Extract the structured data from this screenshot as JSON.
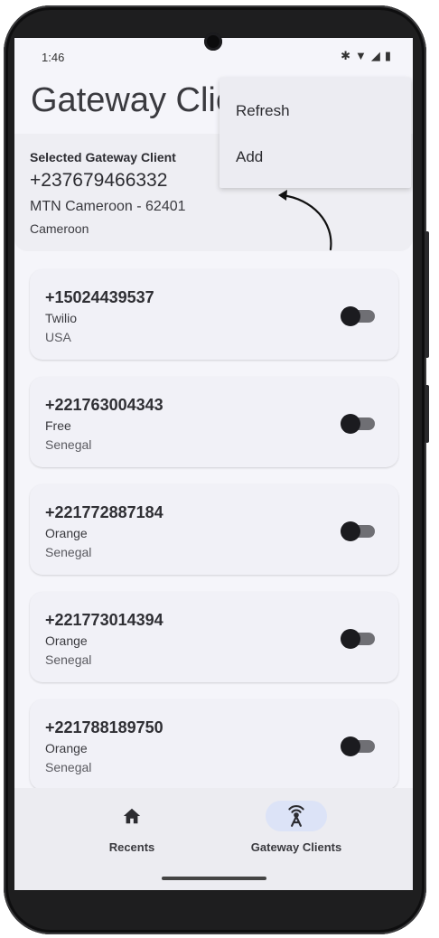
{
  "status_bar": {
    "time": "1:46",
    "icons": [
      "bluetooth-icon",
      "wifi-icon",
      "signal-icon",
      "battery-icon"
    ]
  },
  "header": {
    "title": "Gateway Clients"
  },
  "menu": {
    "items": [
      "Refresh",
      "Add"
    ]
  },
  "selected_client": {
    "label": "Selected Gateway Client",
    "number": "+237679466332",
    "operator": "MTN Cameroon - 62401",
    "country": "Cameroon"
  },
  "clients": [
    {
      "number": "+15024439537",
      "operator": "Twilio",
      "country": "USA",
      "enabled": false
    },
    {
      "number": "+221763004343",
      "operator": "Free",
      "country": "Senegal",
      "enabled": false
    },
    {
      "number": "+221772887184",
      "operator": "Orange",
      "country": "Senegal",
      "enabled": false
    },
    {
      "number": "+221773014394",
      "operator": "Orange",
      "country": "Senegal",
      "enabled": false
    },
    {
      "number": "+221788189750",
      "operator": "Orange",
      "country": "Senegal",
      "enabled": false
    }
  ],
  "bottom_nav": {
    "items": [
      {
        "label": "Recents",
        "icon": "home-icon",
        "active": false
      },
      {
        "label": "Gateway Clients",
        "icon": "antenna-icon",
        "active": true
      }
    ]
  },
  "colors": {
    "active_pill": "#dce3f7",
    "screen_bg": "#f5f5fa",
    "card_bg": "#f1f1f7"
  }
}
